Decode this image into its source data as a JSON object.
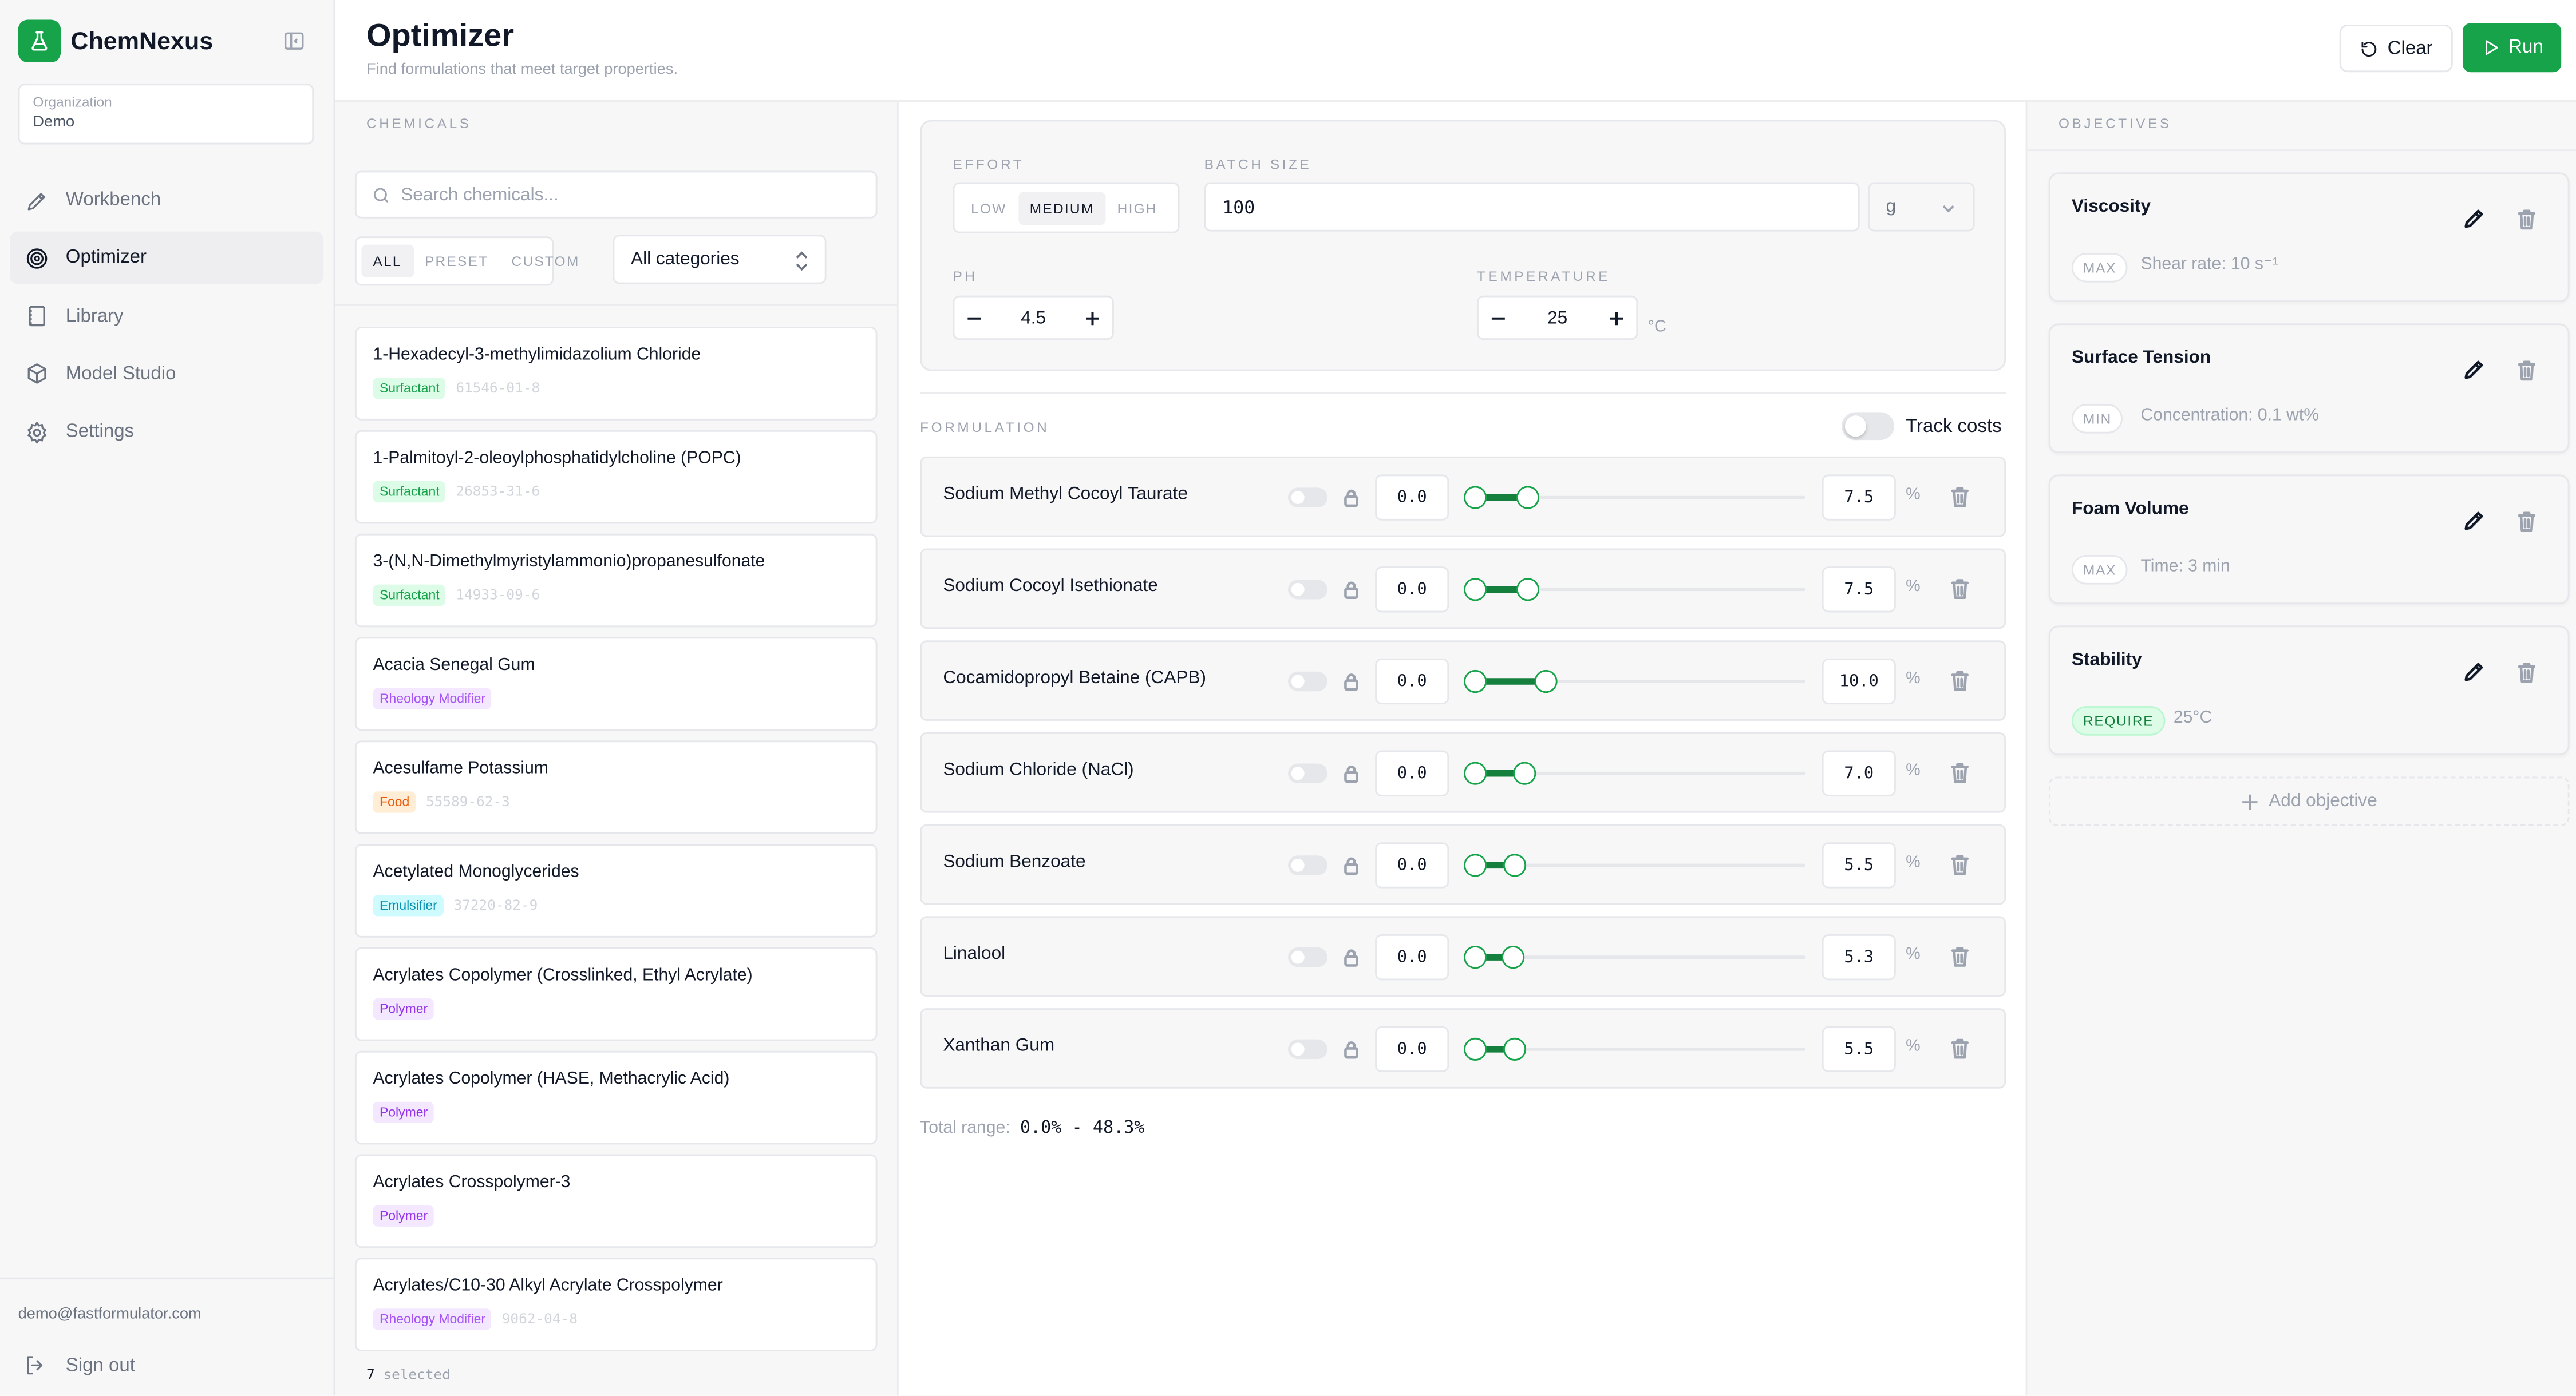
{
  "app": {
    "name": "ChemNexus",
    "org_label": "Organization",
    "org_value": "Demo",
    "user_email": "demo@fastformulator.com",
    "sign_out": "Sign out",
    "accent": "#16a34a"
  },
  "nav": [
    {
      "label": "Workbench",
      "icon": "pencil-icon",
      "active": false
    },
    {
      "label": "Optimizer",
      "icon": "target-icon",
      "active": true
    },
    {
      "label": "Library",
      "icon": "book-icon",
      "active": false
    },
    {
      "label": "Model Studio",
      "icon": "cube-icon",
      "active": false
    },
    {
      "label": "Settings",
      "icon": "gear-icon",
      "active": false
    }
  ],
  "header": {
    "title": "Optimizer",
    "subtitle": "Find formulations that meet target properties.",
    "clear_label": "Clear",
    "run_label": "Run"
  },
  "chemicals": {
    "section_label": "CHEMICALS",
    "search_placeholder": "Search chemicals...",
    "filters": [
      "ALL",
      "PRESET",
      "CUSTOM"
    ],
    "active_filter": "ALL",
    "category": "All categories",
    "items": [
      {
        "name": "1-Hexadecyl-3-methylimidazolium Chloride",
        "tag": "Surfactant",
        "cas": "61546-01-8"
      },
      {
        "name": "1-Palmitoyl-2-oleoylphosphatidylcholine (POPC)",
        "tag": "Surfactant",
        "cas": "26853-31-6"
      },
      {
        "name": "3-(N,N-Dimethylmyristylammonio)propanesulfonate",
        "tag": "Surfactant",
        "cas": "14933-09-6"
      },
      {
        "name": "Acacia Senegal Gum",
        "tag": "Rheology Modifier",
        "cas": ""
      },
      {
        "name": "Acesulfame Potassium",
        "tag": "Food",
        "cas": "55589-62-3"
      },
      {
        "name": "Acetylated Monoglycerides",
        "tag": "Emulsifier",
        "cas": "37220-82-9"
      },
      {
        "name": "Acrylates Copolymer (Crosslinked, Ethyl Acrylate)",
        "tag": "Polymer",
        "cas": ""
      },
      {
        "name": "Acrylates Copolymer (HASE, Methacrylic Acid)",
        "tag": "Polymer",
        "cas": ""
      },
      {
        "name": "Acrylates Crosspolymer-3",
        "tag": "Polymer",
        "cas": ""
      },
      {
        "name": "Acrylates/C10-30 Alkyl Acrylate Crosspolymer",
        "tag": "Rheology Modifier",
        "cas": "9062-04-8"
      }
    ],
    "selected_count": "7",
    "selected_label": "selected"
  },
  "tag_colors": {
    "Surfactant": {
      "bg": "#dcfce7",
      "fg": "#16a34a"
    },
    "Rheology Modifier": {
      "bg": "#f3e8ff",
      "fg": "#a855f7"
    },
    "Food": {
      "bg": "#ffedd5",
      "fg": "#ea580c"
    },
    "Emulsifier": {
      "bg": "#cffafe",
      "fg": "#0891b2"
    },
    "Polymer": {
      "bg": "#f3e8ff",
      "fg": "#9333ea"
    }
  },
  "params": {
    "effort_label": "EFFORT",
    "effort_options": [
      "LOW",
      "MEDIUM",
      "HIGH"
    ],
    "effort_selected": "MEDIUM",
    "batch_label": "BATCH SIZE",
    "batch_value": "100",
    "batch_unit": "g",
    "ph_label": "PH",
    "ph_value": "4.5",
    "temp_label": "TEMPERATURE",
    "temp_value": "25",
    "temp_unit": "°C"
  },
  "formulation": {
    "section_label": "FORMULATION",
    "track_costs_label": "Track costs",
    "slider_scale_max": 48.3,
    "rows": [
      {
        "name": "Sodium Methyl Cocoyl Taurate",
        "min": "0.0",
        "max": "7.5",
        "min_val": 0.0,
        "max_val": 7.5
      },
      {
        "name": "Sodium Cocoyl Isethionate",
        "min": "0.0",
        "max": "7.5",
        "min_val": 0.0,
        "max_val": 7.5
      },
      {
        "name": "Cocamidopropyl Betaine (CAPB)",
        "min": "0.0",
        "max": "10.0",
        "min_val": 0.0,
        "max_val": 10.0
      },
      {
        "name": "Sodium Chloride (NaCl)",
        "min": "0.0",
        "max": "7.0",
        "min_val": 0.0,
        "max_val": 7.0
      },
      {
        "name": "Sodium Benzoate",
        "min": "0.0",
        "max": "5.5",
        "min_val": 0.0,
        "max_val": 5.5
      },
      {
        "name": "Linalool",
        "min": "0.0",
        "max": "5.3",
        "min_val": 0.0,
        "max_val": 5.3
      },
      {
        "name": "Xanthan Gum",
        "min": "0.0",
        "max": "5.5",
        "min_val": 0.0,
        "max_val": 5.5
      }
    ],
    "unit": "%",
    "total_label": "Total range:",
    "total_value": "0.0% - 48.3%"
  },
  "objectives": {
    "section_label": "OBJECTIVES",
    "items": [
      {
        "name": "Viscosity",
        "badge": "MAX",
        "desc": "Shear rate: 10 s⁻¹",
        "required": false
      },
      {
        "name": "Surface Tension",
        "badge": "MIN",
        "desc": "Concentration: 0.1 wt%",
        "required": false
      },
      {
        "name": "Foam Volume",
        "badge": "MAX",
        "desc": "Time: 3 min",
        "required": false
      },
      {
        "name": "Stability",
        "badge": "REQUIRE",
        "desc": "25°C",
        "required": true
      }
    ],
    "add_label": "Add objective"
  }
}
